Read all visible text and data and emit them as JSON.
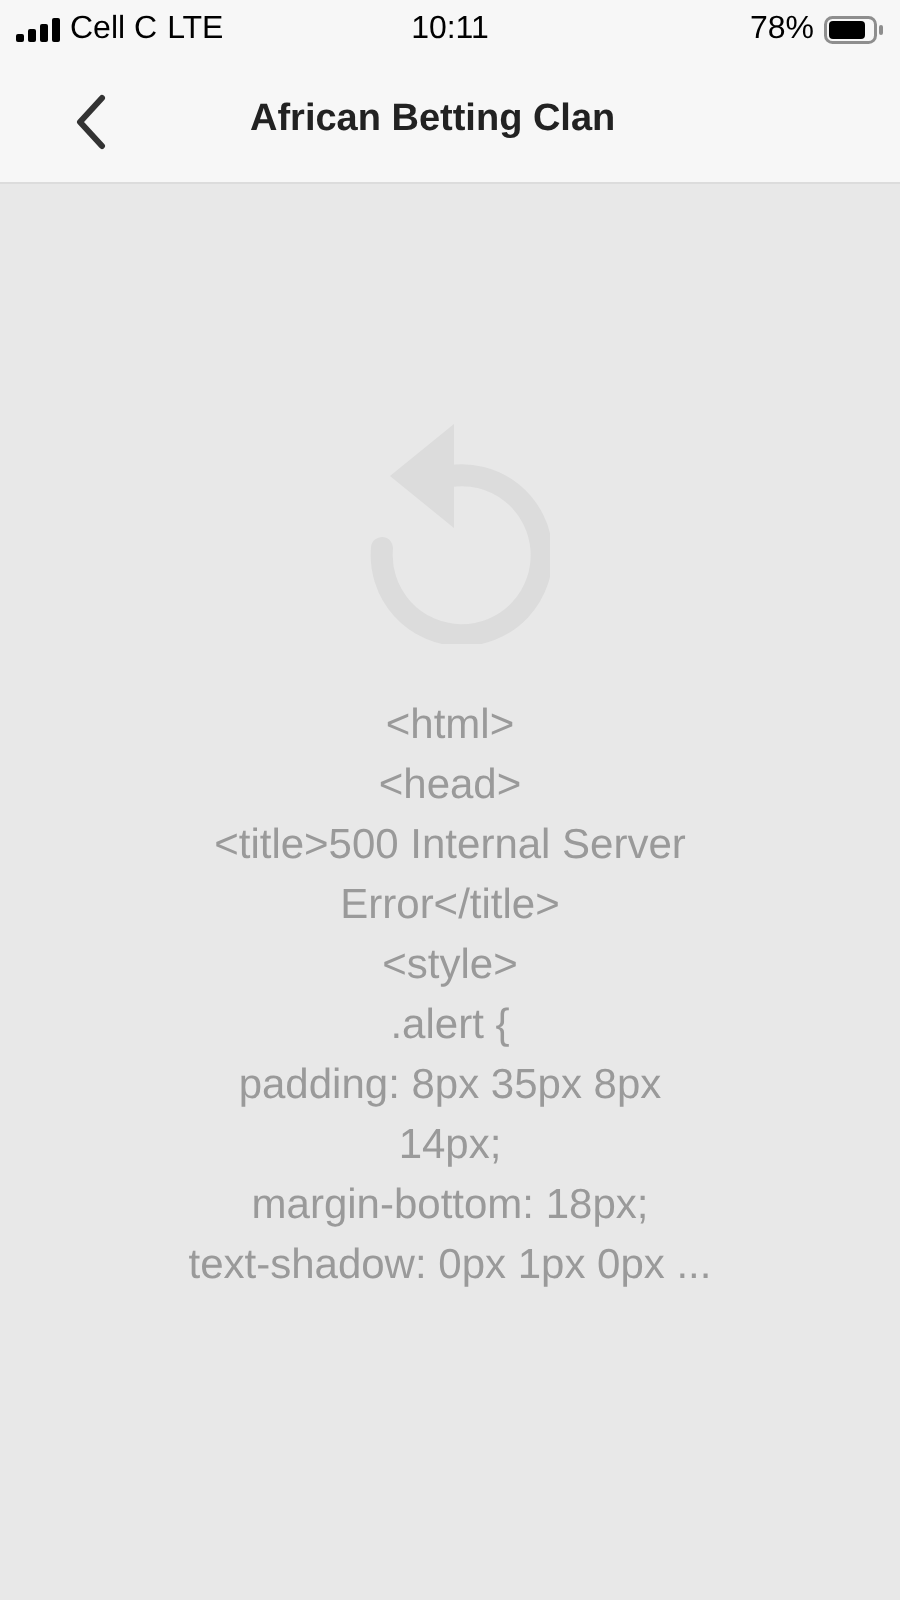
{
  "status_bar": {
    "carrier": "Cell C",
    "network": "LTE",
    "time": "10:11",
    "battery": "78%"
  },
  "nav_bar": {
    "title": "African Betting Clan"
  },
  "error_message": "<html>\n<head>\n<title>500 Internal Server\nError</title>\n<style>\n.alert {\npadding: 8px 35px 8px\n14px;\nmargin-bottom: 18px;\ntext-shadow: 0px 1px 0px ..."
}
